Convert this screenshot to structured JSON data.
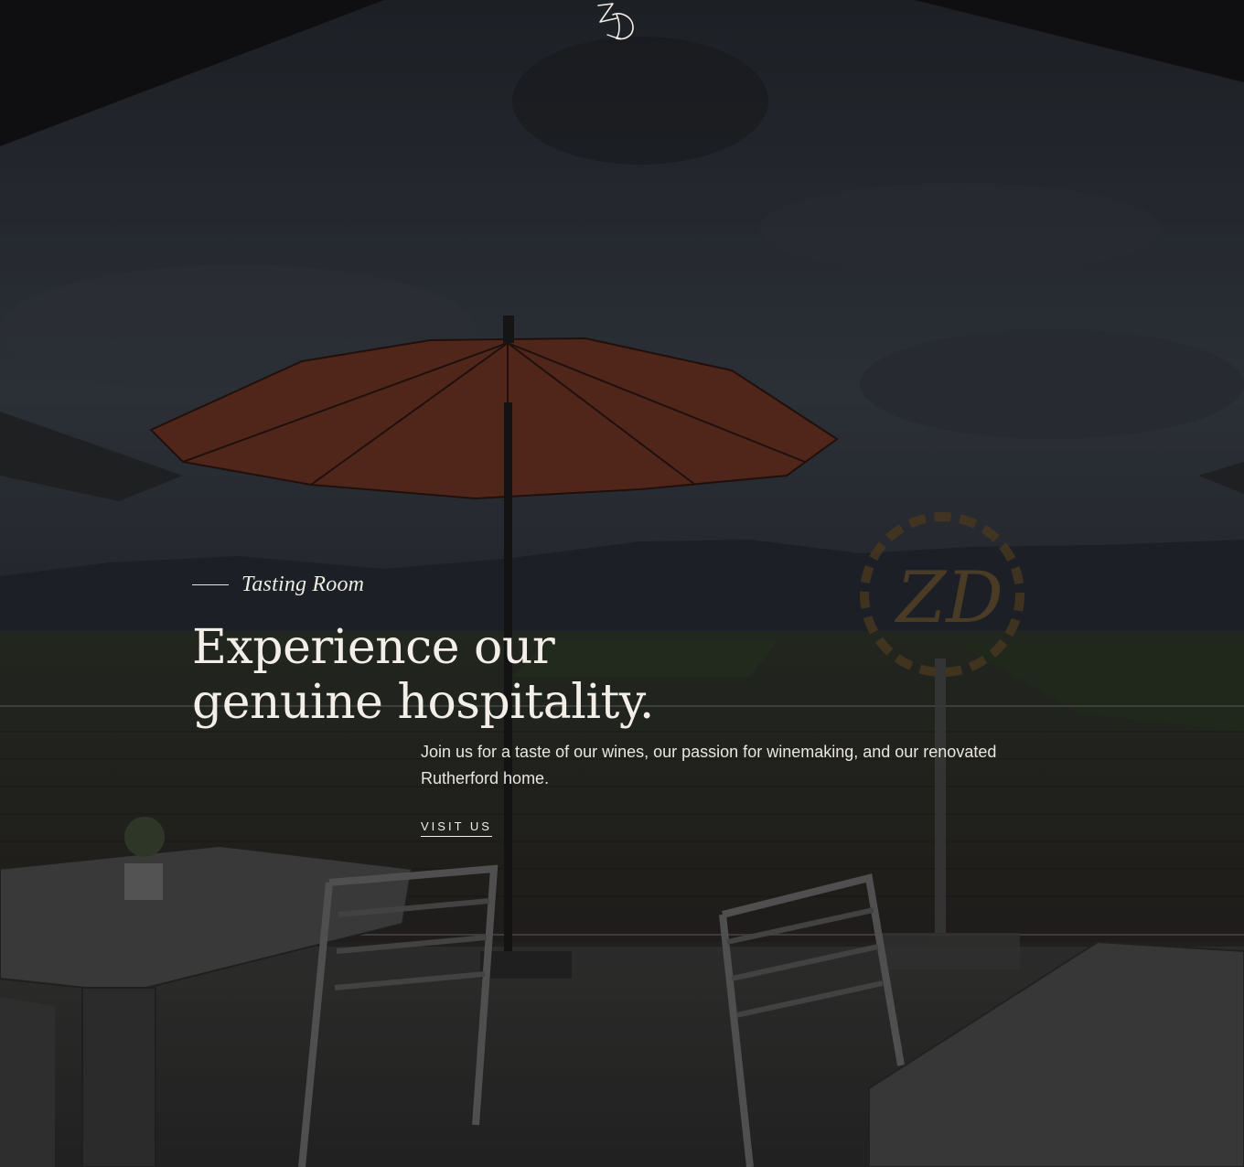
{
  "logo": {
    "icon": "zd-monogram-icon",
    "color": "#f3efe8"
  },
  "hero": {
    "eyebrow": "Tasting Room",
    "headline_line1": "Experience our",
    "headline_line2": "genuine hospitality.",
    "body": "Join us for a taste of our wines, our passion for winemaking, and our renovated Rutherford home.",
    "cta_label": "VISIT US"
  },
  "colors": {
    "text": "#f3efe8",
    "umbrella": "#8a3f2a",
    "overlay": "#000000"
  }
}
